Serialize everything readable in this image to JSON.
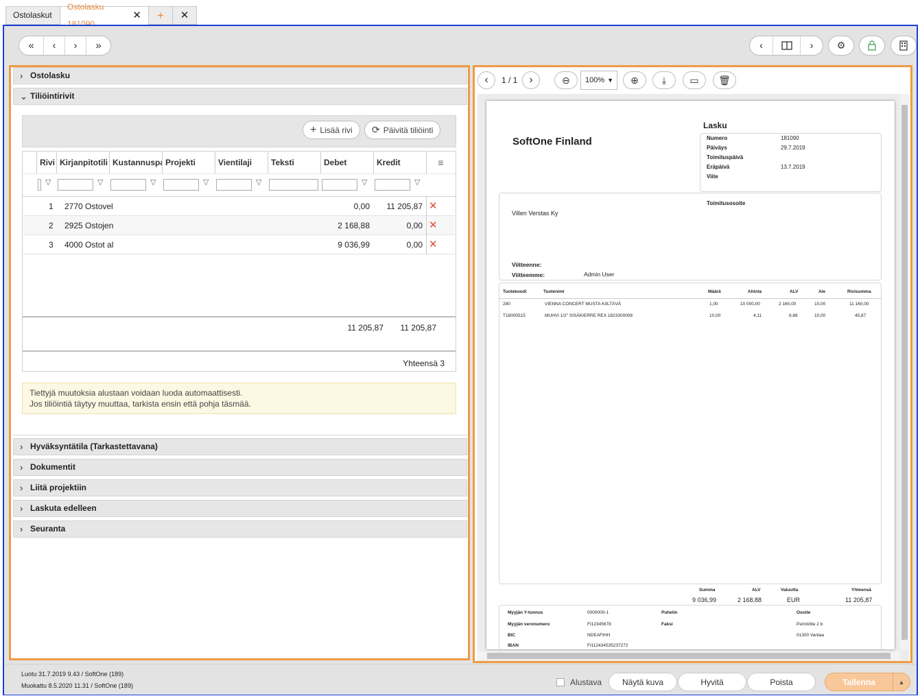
{
  "tabs": [
    {
      "label": "Ostolaskut"
    },
    {
      "label": "Ostolasku 181090"
    }
  ],
  "sections": {
    "ostolasku": "Ostolasku",
    "tiliointirivit": "Tiliöintirivit",
    "hyvaksynta": "Hyväksyntätila (Tarkastettavana)",
    "dokumentit": "Dokumentit",
    "liita": "Liitä projektiin",
    "laskuta": "Laskuta edelleen",
    "seuranta": "Seuranta"
  },
  "grid": {
    "add_row": "Lisää rivi",
    "refresh": "Päivitä tiliöinti",
    "columns": [
      "Rivi",
      "Kirjanpitotili",
      "Kustannuspa...",
      "Projekti",
      "Vientilaji",
      "Teksti",
      "Debet",
      "Kredit"
    ],
    "rows": [
      {
        "rivi": "1",
        "tili": "2770 Ostovel",
        "debet": "0,00",
        "kredit": "11 205,87"
      },
      {
        "rivi": "2",
        "tili": "2925 Ostojen",
        "debet": "2 168,88",
        "kredit": "0,00"
      },
      {
        "rivi": "3",
        "tili": "4000 Ostot al",
        "debet": "9 036,99",
        "kredit": "0,00"
      }
    ],
    "total_debet": "11 205,87",
    "total_kredit": "11 205,87",
    "count": "Yhteensä 3"
  },
  "notice": {
    "line1": "Tiettyjä muutoksia alustaan voidaan luoda automaattisesti.",
    "line2": "Jos tiliöintiä täytyy muuttaa, tarkista ensin että pohja täsmää."
  },
  "viewer": {
    "page": "1 / 1",
    "zoom": "100%"
  },
  "invoice": {
    "company": "SoftOne Finland",
    "title": "Lasku",
    "meta": [
      {
        "k": "Numero",
        "v": "181090"
      },
      {
        "k": "Päiväys",
        "v": "29.7.2019"
      },
      {
        "k": "Toimituspäivä",
        "v": ""
      },
      {
        "k": "Eräpäivä",
        "v": "13.7.2019"
      },
      {
        "k": "Viite",
        "v": ""
      }
    ],
    "customer": "Villen Verstas Ky",
    "delivery_label": "Toimitusosoite",
    "viitteenne": "Viitteenne:",
    "viitteemme": "Viitteemme:",
    "viitteemme_value": "Admin User",
    "cols": [
      "Tuotekoodi",
      "Tuotenimi",
      "Määrä",
      "Ahinta",
      "ALV",
      "Ale",
      "Rivisumma"
    ],
    "lines": [
      [
        "280",
        "VIENNA CONCERT MUSTA KIILTÄVÄ",
        "1,00",
        "10 000,00",
        "2 160,00",
        "10,00",
        "11 160,00"
      ],
      [
        "T18000515",
        "MUHVI 1/2\" SISÄKIERRE REX 1823300008",
        "10,00",
        "4,11",
        "8,88",
        "10,00",
        "45,87"
      ]
    ],
    "sum_labels": [
      "Summa",
      "ALV",
      "Valuutta",
      "Yhteensä"
    ],
    "sum_values": [
      "9 036,99",
      "2 168,88",
      "EUR",
      "11 205,87"
    ],
    "seller": [
      {
        "k": "Myyjän Y-tunnus",
        "v": "0000000-1"
      },
      {
        "k": "Myyjän veronumero",
        "v": "FI12345678"
      },
      {
        "k": "BIC",
        "v": "NDEAFIHH"
      },
      {
        "k": "IBAN",
        "v": "FI112434535237272"
      }
    ],
    "phone": "Puhelin",
    "fax": "Faksi",
    "address_label": "Osoite",
    "address1": "Perintötie 2 b",
    "address2": "01300 Vantaa"
  },
  "footer": {
    "created": "Luotu 31.7.2019 9.43 / SoftOne (189)",
    "modified": "Muokattu 8.5.2020 11.31 / SoftOne (189)",
    "draft": "Alustava",
    "show_image": "Näytä kuva",
    "approve": "Hyvitä",
    "delete": "Poista",
    "save": "Tallenna"
  }
}
